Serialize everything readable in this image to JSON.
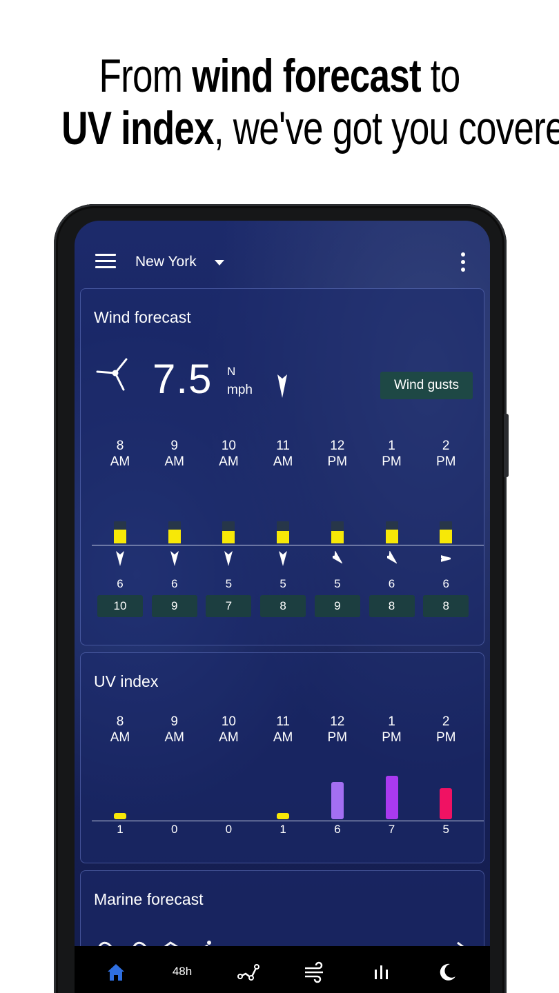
{
  "headline": {
    "line1_pre": "From ",
    "line1_bold": "wind forecast",
    "line1_post": " to",
    "line2_bold": "UV index",
    "line2_post": ", we've got you covered"
  },
  "appbar": {
    "city": "New York",
    "icons": {
      "menu": "menu-icon",
      "dropdown": "caret-down-icon",
      "more": "more-vertical-icon"
    }
  },
  "wind": {
    "title": "Wind forecast",
    "speed": "7.5",
    "direction": "N",
    "unit": "mph",
    "gusts_button": "Wind gusts",
    "bar_color": "#f7e807",
    "hours": [
      {
        "h": "8",
        "p": "AM",
        "speed": "6",
        "gust": "10",
        "dir_deg": 180,
        "level": 0.62
      },
      {
        "h": "9",
        "p": "AM",
        "speed": "6",
        "gust": "9",
        "dir_deg": 180,
        "level": 0.62
      },
      {
        "h": "10",
        "p": "AM",
        "speed": "5",
        "gust": "7",
        "dir_deg": 180,
        "level": 0.55
      },
      {
        "h": "11",
        "p": "AM",
        "speed": "5",
        "gust": "8",
        "dir_deg": 180,
        "level": 0.55
      },
      {
        "h": "12",
        "p": "PM",
        "speed": "5",
        "gust": "9",
        "dir_deg": 135,
        "level": 0.55
      },
      {
        "h": "1",
        "p": "PM",
        "speed": "6",
        "gust": "8",
        "dir_deg": 135,
        "level": 0.62
      },
      {
        "h": "2",
        "p": "PM",
        "speed": "6",
        "gust": "8",
        "dir_deg": 90,
        "level": 0.62
      }
    ]
  },
  "uv": {
    "title": "UV index",
    "max": 8,
    "hours": [
      {
        "h": "8",
        "p": "AM",
        "value": 1,
        "label": "1",
        "color": "#f7e807"
      },
      {
        "h": "9",
        "p": "AM",
        "value": 0,
        "label": "0",
        "color": "#f7e807"
      },
      {
        "h": "10",
        "p": "AM",
        "value": 0,
        "label": "0",
        "color": "#f7e807"
      },
      {
        "h": "11",
        "p": "AM",
        "value": 1,
        "label": "1",
        "color": "#f7e807"
      },
      {
        "h": "12",
        "p": "PM",
        "value": 6,
        "label": "6",
        "color": "#a36ff2"
      },
      {
        "h": "1",
        "p": "PM",
        "value": 7,
        "label": "7",
        "color": "#a93af0"
      },
      {
        "h": "2",
        "p": "PM",
        "value": 5,
        "label": "5",
        "color": "#f01263"
      }
    ]
  },
  "marine": {
    "title": "Marine forecast"
  },
  "nav": {
    "label_48h": "48h",
    "accent": "#2f6fe0",
    "icons": [
      "home-icon",
      "48h-tab",
      "graph-icon",
      "wind-icon",
      "bar-chart-icon",
      "moon-icon"
    ]
  }
}
